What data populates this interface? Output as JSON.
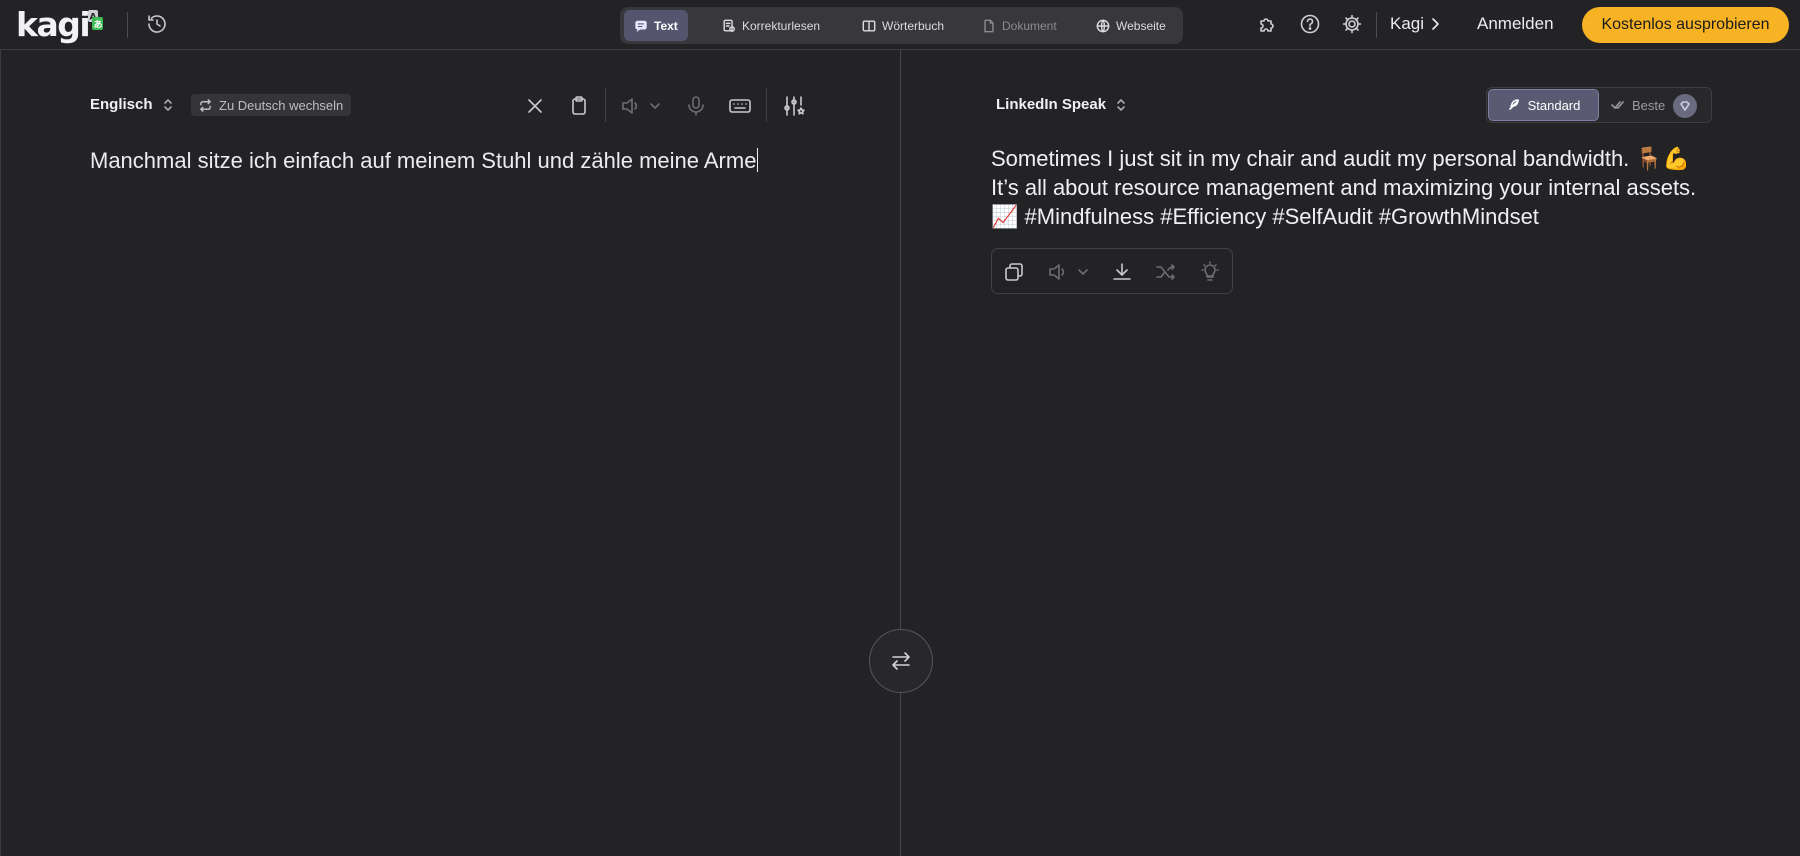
{
  "app": {
    "logo_text": "kagi",
    "colors": {
      "accent": "#f8b324",
      "active_tab": "#55556f",
      "background": "#232325"
    }
  },
  "topbar": {
    "history_icon": "history-icon",
    "tabs": [
      {
        "label": "Text",
        "icon": "chat-bubble-icon",
        "active": true,
        "enabled": true
      },
      {
        "label": "Korrekturlesen",
        "icon": "proofread-icon",
        "active": false,
        "enabled": true
      },
      {
        "label": "Wörterbuch",
        "icon": "book-icon",
        "active": false,
        "enabled": true
      },
      {
        "label": "Dokument",
        "icon": "document-icon",
        "active": false,
        "enabled": false
      },
      {
        "label": "Webseite",
        "icon": "globe-icon",
        "active": false,
        "enabled": true
      }
    ],
    "right_icons": [
      "extension-icon",
      "help-icon",
      "settings-icon"
    ],
    "kagi_link": "Kagi",
    "login": "Anmelden",
    "cta": "Kostenlos ausprobieren"
  },
  "source": {
    "language": "Englisch",
    "switch_label": "Zu Deutsch wechseln",
    "text": "Manchmal sitze ich einfach auf meinem Stuhl und zähle meine Arme"
  },
  "target": {
    "language": "LinkedIn Speak",
    "quality": {
      "standard": "Standard",
      "best": "Beste",
      "selected": "Standard"
    },
    "text": "Sometimes I just sit in my chair and audit my personal bandwidth. 🪑💪 It’s all about resource management and maximizing your internal assets. 📈 #Mindfulness #Efficiency #SelfAudit #GrowthMindset"
  }
}
